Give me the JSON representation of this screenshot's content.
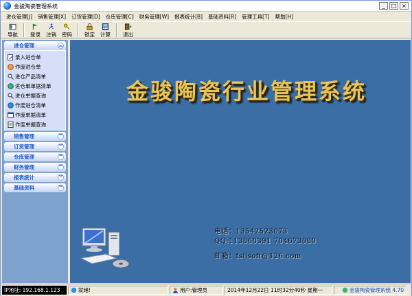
{
  "window": {
    "title": "金骏陶瓷管理系统",
    "controls": [
      "_",
      "□",
      "×"
    ]
  },
  "menu": [
    "进仓管理[J]",
    "销售管理[X]",
    "订货管理[D]",
    "仓库管理[C]",
    "财务管理[W]",
    "报表统计[B]",
    "基础资料[R]",
    "管理工具[T]",
    "帮助[H]"
  ],
  "toolbar": {
    "nav": "导航",
    "login": "登录",
    "logout": "注销",
    "password": "密码",
    "lock": "锁定",
    "calc": "计算",
    "exit": "退出"
  },
  "sidebar": {
    "open_panel": {
      "title": "进仓管理",
      "items": [
        "录入进仓单",
        "作废进仓单",
        "进仓产品清单",
        "进仓单单据清单",
        "进仓单据查询",
        "作废进仓清单",
        "作废单据清单",
        "作废单据查询"
      ]
    },
    "closed_panels": [
      "销售管理",
      "订货管理",
      "仓库管理",
      "财务管理",
      "报表统计",
      "基础资料"
    ]
  },
  "main": {
    "title": "金骏陶瓷行业管理系统",
    "phone": "电话：13542523073",
    "qq": "QQ:113860391  704673080",
    "email": "邮箱：fsljsoft@126.com"
  },
  "status": {
    "ip": "IP地址: 192.168.1.123",
    "ready": "就绪!",
    "user": "用户:管理员",
    "datetime": "2014年12月22日  11时32分40秒  星期一",
    "version": "金骏陶瓷管理系统  4.70"
  },
  "colors": {
    "main_bg": "#3a6ea5",
    "title_gold": "#e8c45b",
    "sidebar_bg": "#7da2ce",
    "panel_link": "#215dc6"
  }
}
